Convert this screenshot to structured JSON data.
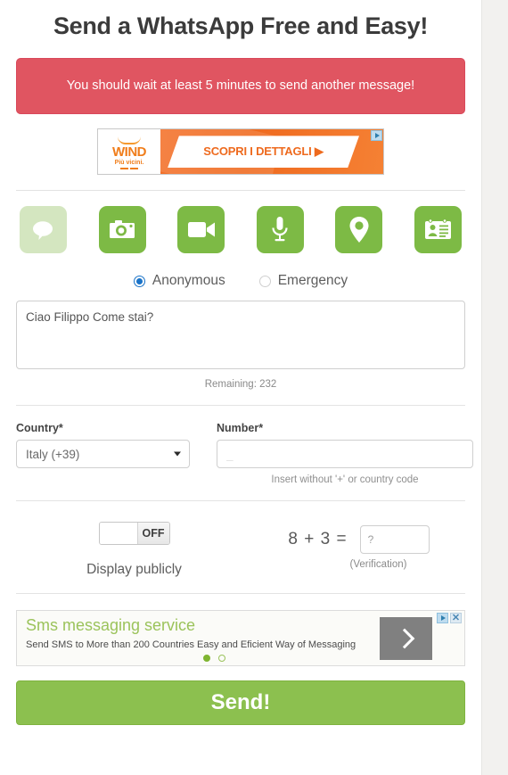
{
  "page": {
    "title": "Send a WhatsApp Free and Easy!"
  },
  "alert": {
    "text": "You should wait at least 5 minutes to send another message!",
    "color": "#e05561"
  },
  "ad_top": {
    "brand": "WIND",
    "brand_tagline": "Più vicini.",
    "cta": "SCOPRI I DETTAGLI ▶",
    "adchoices_icon": "adchoices-icon"
  },
  "media_icons": [
    {
      "name": "chat-icon",
      "label": "Text message",
      "active": false
    },
    {
      "name": "camera-icon",
      "label": "Photo",
      "active": true
    },
    {
      "name": "video-icon",
      "label": "Video",
      "active": true
    },
    {
      "name": "microphone-icon",
      "label": "Audio",
      "active": true
    },
    {
      "name": "location-pin-icon",
      "label": "Location",
      "active": true
    },
    {
      "name": "contact-card-icon",
      "label": "Contact",
      "active": true
    }
  ],
  "mode": {
    "options": [
      {
        "label": "Anonymous",
        "selected": true
      },
      {
        "label": "Emergency",
        "selected": false
      }
    ]
  },
  "message": {
    "value": "Ciao Filippo Come stai?",
    "remaining_label": "Remaining: 232"
  },
  "country": {
    "label": "Country*",
    "selected": "Italy (+39)"
  },
  "number": {
    "label": "Number*",
    "placeholder": "_",
    "value": "",
    "hint": "Insert without '+' or country code"
  },
  "display_publicly": {
    "state_label": "OFF",
    "caption": "Display publicly"
  },
  "verification": {
    "question": "8 + 3 =",
    "placeholder": "?",
    "value": "",
    "caption": "(Verification)"
  },
  "ad_bottom": {
    "title": "Sms messaging service",
    "subtitle": "Send SMS to More than 200 Countries Easy and Eficient Way of Messaging",
    "arrow_icon": "chevron-right-icon",
    "adchoices_icon": "adchoices-icon",
    "close_icon": "close-icon"
  },
  "send": {
    "label": "Send!",
    "color": "#8cc04f"
  }
}
